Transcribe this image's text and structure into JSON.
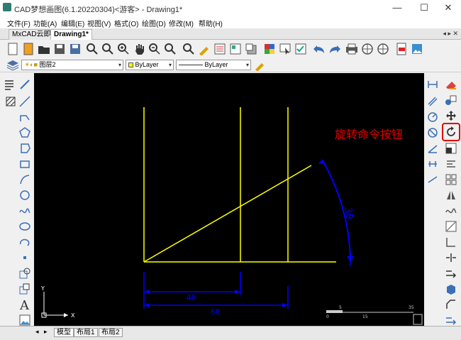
{
  "window": {
    "title": "CAD梦想画图(6.1.20220304)<游客> - Drawing1*",
    "minimize": "—",
    "maximize": "☐",
    "close": "✕"
  },
  "menu": [
    "文件(F)",
    "功能(A)",
    "编辑(E)",
    "视图(V)",
    "格式(O)",
    "绘图(D)",
    "修改(M)",
    "帮助(H)"
  ],
  "tabs": {
    "items": [
      "MxCAD云即",
      "Drawing1*"
    ],
    "active": "Drawing1*",
    "controls": "◂ ▸ ✕"
  },
  "layer_bar": {
    "layer_name": "图层2",
    "color": "ByLayer",
    "linetype": "ByLayer"
  },
  "drawing": {
    "dim_inner": "40",
    "dim_outer": "60",
    "dim_angle": "30",
    "ucs_x": "X",
    "ucs_y": "Y",
    "scale_top_left": "5",
    "scale_top_right": "35",
    "scale_bottom_left": "0",
    "scale_bottom_mid": "15",
    "colors": {
      "background": "#000000",
      "geometry": "#ffff00",
      "dimension": "#0000ff",
      "ucs": "#ffffff"
    }
  },
  "annotation": {
    "text": "旋转命令按钮",
    "color": "#e00000"
  },
  "layout_tabs": [
    "模型",
    "布局1",
    "布局2"
  ],
  "layout_nav": [
    "◂",
    "▸"
  ]
}
